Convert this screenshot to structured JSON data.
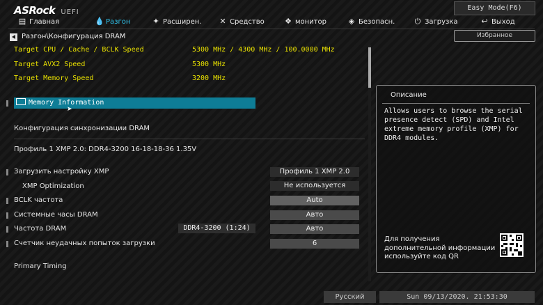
{
  "header": {
    "logo": "ASRock",
    "logo_suffix": "UEFI",
    "easy_mode": "Easy Mode(F6)",
    "favorites": "Избранное"
  },
  "nav": [
    {
      "label": "Главная",
      "icon": "main-icon"
    },
    {
      "label": "Разгон",
      "icon": "flame-icon",
      "active": true
    },
    {
      "label": "Расширен.",
      "icon": "star-icon"
    },
    {
      "label": "Средство",
      "icon": "tools-icon"
    },
    {
      "label": "монитор",
      "icon": "monitor-icon"
    },
    {
      "label": "Безопасн.",
      "icon": "shield-icon"
    },
    {
      "label": "Загрузка",
      "icon": "power-icon"
    },
    {
      "label": "Выход",
      "icon": "exit-icon"
    }
  ],
  "breadcrumb": "Разгон\\Конфигурация DRAM",
  "info_rows": [
    {
      "label": "Target CPU / Cache / BCLK Speed",
      "value": "5300 MHz / 4300 MHz / 100.0000 MHz"
    },
    {
      "label": "Target AVX2 Speed",
      "value": "5300 MHz"
    },
    {
      "label": "Target Memory Speed",
      "value": "3200 MHz"
    }
  ],
  "memory_info": "Memory Information",
  "dram_sync_header": "Конфигурация синхронизации DRAM",
  "xmp_profile": "Профиль 1 XMP 2.0: DDR4-3200 16-18-18-36 1.35V",
  "settings": [
    {
      "label": "Загрузить настройку XMP",
      "value": "Профиль 1 XMP 2.0"
    },
    {
      "label": "XMP Optimization",
      "value": "Не используется"
    },
    {
      "label": "BCLK частота",
      "value": "Auto"
    },
    {
      "label": "Системные часы DRAM",
      "value": "Авто"
    },
    {
      "label": "Частота DRAM",
      "value": "Авто",
      "extra": "DDR4-3200 (1:24)"
    },
    {
      "label": "Счетчик неудачных попыток загрузки",
      "value": "6"
    }
  ],
  "primary_timing": "Primary Timing",
  "description": {
    "title": "Описание",
    "text": "Allows users to browse the serial\npresence detect (SPD) and Intel\nextreme memory profile (XMP) for\nDDR4 modules.",
    "qr_text": "Для получения\nдополнительной информации\nиспользуйте код QR"
  },
  "footer": {
    "language": "Русский",
    "datetime": "Sun 09/13/2020. 21:53:30"
  },
  "colors": {
    "accent": "#2ec0e8",
    "highlight": "#0e7d96",
    "value_yellow": "#e8e000"
  }
}
